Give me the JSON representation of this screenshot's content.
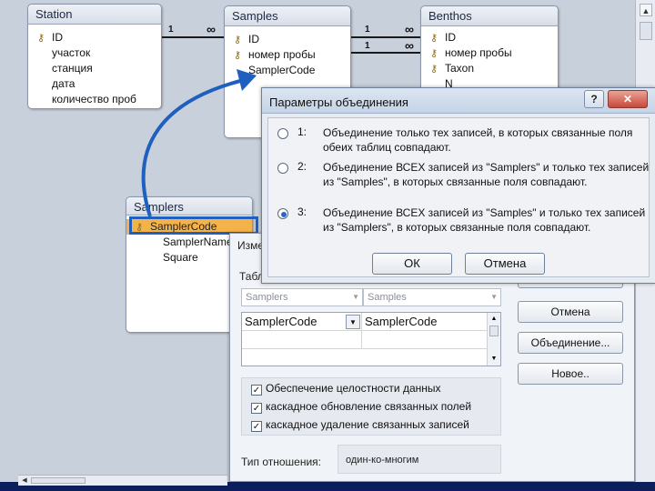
{
  "tables": {
    "station": {
      "title": "Station",
      "fields": [
        "ID",
        "участок",
        "станция",
        "дата",
        "количество проб"
      ],
      "keys": [
        0
      ]
    },
    "samples": {
      "title": "Samples",
      "fields": [
        "ID",
        "номер пробы",
        "SamplerCode"
      ],
      "keys": [
        0,
        1
      ]
    },
    "benthos": {
      "title": "Benthos",
      "fields": [
        "ID",
        "номер пробы",
        "Taxon",
        "N"
      ],
      "keys": [
        0,
        1,
        2
      ]
    },
    "samplers": {
      "title": "Samplers",
      "fields": [
        "SamplerCode",
        "SamplerName",
        "Square"
      ],
      "keys": [
        0
      ],
      "selected": 0
    }
  },
  "relations": {
    "one": "1",
    "many": "∞"
  },
  "edit_dialog": {
    "title": "Изме",
    "tables_label": "Табл",
    "left_table": "Samplers",
    "right_table": "Samples",
    "left_field": "SamplerCode",
    "right_field": "SamplerCode",
    "checkboxes": [
      {
        "label": "Обеспечение целостности данных",
        "checked": true
      },
      {
        "label": "каскадное обновление связанных полей",
        "checked": true
      },
      {
        "label": "каскадное удаление связанных записей",
        "checked": true
      }
    ],
    "relation_type_label": "Тип отношения:",
    "relation_type_value": "один-ко-многим",
    "buttons": {
      "cancel": "Отмена",
      "join": "Объединение...",
      "new": "Новое.."
    }
  },
  "join_dialog": {
    "title": "Параметры объединения",
    "help": "?",
    "close": "✕",
    "options": [
      {
        "num": "1:",
        "text": "Объединение только тех записей, в которых связанные поля обеих таблиц совпадают.",
        "selected": false
      },
      {
        "num": "2:",
        "text": "Объединение ВСЕХ записей из \"Samplers\" и только тех записей из \"Samples\", в которых связанные поля совпадают.",
        "selected": false
      },
      {
        "num": "3:",
        "text": "Объединение ВСЕХ записей из \"Samples\" и только тех записей из \"Samplers\", в которых связанные поля совпадают.",
        "selected": true
      }
    ],
    "ok": "ОК",
    "cancel": "Отмена"
  },
  "colors": {
    "accent_blue": "#1f5fbf",
    "selection_orange": "#f3b24a"
  }
}
